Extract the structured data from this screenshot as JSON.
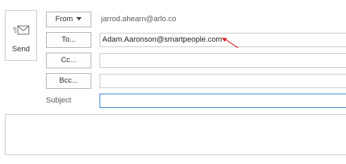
{
  "send": {
    "label": "Send",
    "icon": "send-envelope-icon"
  },
  "header": {
    "from_label": "From",
    "from_value": "jarrod.ahearn@arlo.co",
    "to_label": "To...",
    "to_value": "Adam.Aaronson@smartpeople.com",
    "cc_label": "Cc...",
    "cc_value": "",
    "bcc_label": "Bcc...",
    "bcc_value": "",
    "subject_label": "Subject",
    "subject_value": ""
  },
  "annotation": {
    "icon": "red-arrow-icon",
    "color": "#e0242b"
  },
  "colors": {
    "focus_border": "#2b79d8",
    "field_border": "#c6c6c6"
  }
}
